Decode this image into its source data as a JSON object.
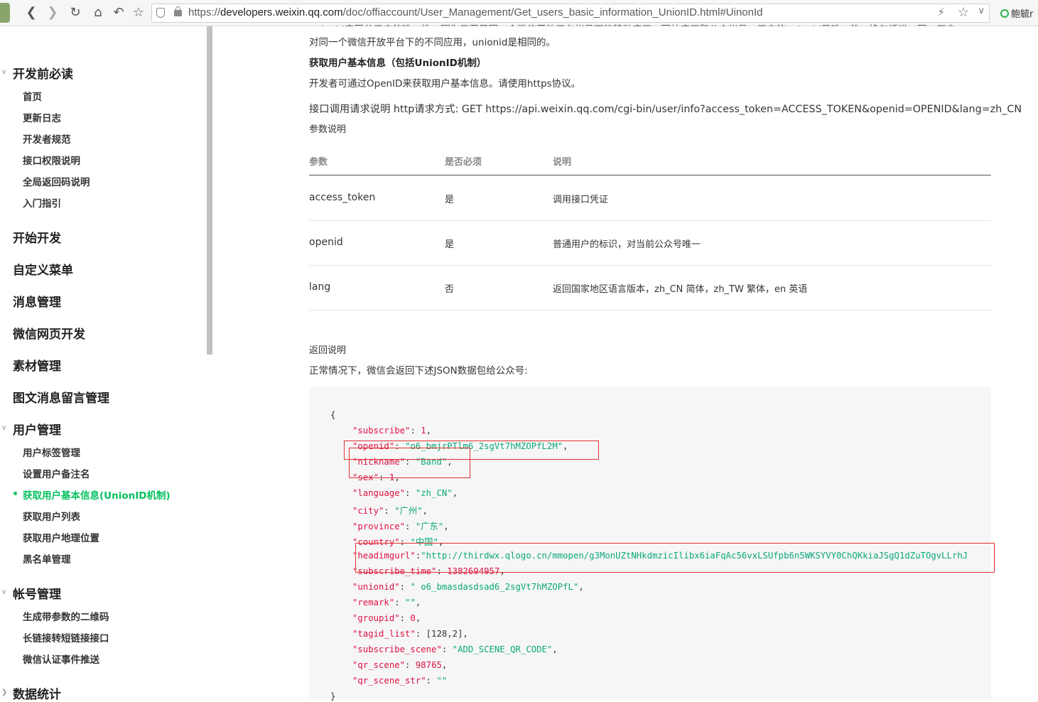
{
  "browser": {
    "url_prefix": "https://",
    "url_host": "developers.weixin.qq.com",
    "url_path": "/doc/offiaccount/User_Management/Get_users_basic_information_UnionID.html#UinonId",
    "extension_label": "鲍毓r"
  },
  "sidebar": {
    "sections": [
      {
        "label": "开发前必读",
        "items": [
          "首页",
          "更新日志",
          "开发者规范",
          "接口权限说明",
          "全局返回码说明",
          "入门指引"
        ]
      },
      {
        "label": "开始开发"
      },
      {
        "label": "自定义菜单"
      },
      {
        "label": "消息管理"
      },
      {
        "label": "微信网页开发"
      },
      {
        "label": "素材管理"
      },
      {
        "label": "图文消息留言管理"
      },
      {
        "label": "用户管理",
        "items": [
          "用户标签管理",
          "设置用户备注名",
          "获取用户基本信息(UnionID机制)",
          "获取用户列表",
          "获取用户地理位置",
          "黑名单管理"
        ],
        "active_item": "获取用户基本信息(UnionID机制)"
      },
      {
        "label": "帐号管理",
        "items": [
          "生成带参数的二维码",
          "长链接转短链接接口",
          "微信认证事件推送"
        ]
      },
      {
        "label": "数据统计"
      }
    ]
  },
  "content": {
    "intro_line_cut": "unionid来区分用户的唯一性，因为只要是同一个微信开放平台帐号下的移动应用、网站应用和公众帐号，用户的unionid是唯一的。换句话说，同一用户，",
    "intro_line2": "对同一个微信开放平台下的不同应用，unionid是相同的。",
    "heading": "获取用户基本信息（包括UnionID机制）",
    "desc": "开发者可通过OpenID来获取用户基本信息。请使用https协议。",
    "request": "接口调用请求说明 http请求方式: GET https://api.weixin.qq.com/cgi-bin/user/info?access_token=ACCESS_TOKEN&openid=OPENID&lang=zh_CN",
    "params_title": "参数说明",
    "table": {
      "headers": [
        "参数",
        "是否必须",
        "说明"
      ],
      "rows": [
        [
          "access_token",
          "是",
          "调用接口凭证"
        ],
        [
          "openid",
          "是",
          "普通用户的标识，对当前公众号唯一"
        ],
        [
          "lang",
          "否",
          "返回国家地区语言版本，zh_CN 简体，zh_TW 繁体，en 英语"
        ]
      ]
    },
    "return_title": "返回说明",
    "return_desc": "正常情况下，微信会返回下述JSON数据包给公众号:",
    "json_lines": [
      {
        "key": "",
        "val": "{",
        "type": "brace"
      },
      {
        "key": "\"subscribe\"",
        "val": "1",
        "type": "num"
      },
      {
        "key": "\"openid\"",
        "val": "\"o6_bmjrPTlm6_2sgVt7hMZOPfL2M\"",
        "type": "str"
      },
      {
        "key": "\"nickname\"",
        "val": "\"Band\"",
        "type": "str"
      },
      {
        "key": "\"sex\"",
        "val": "1",
        "type": "num"
      },
      {
        "key": "\"language\"",
        "val": "\"zh_CN\"",
        "type": "str"
      },
      {
        "key": "\"city\"",
        "val": "\"广州\"",
        "type": "str"
      },
      {
        "key": "\"province\"",
        "val": "\"广东\"",
        "type": "str"
      },
      {
        "key": "\"country\"",
        "val": "\"中国\"",
        "type": "str"
      },
      {
        "key": "\"headimgurl\"",
        "val": "\"http://thirdwx.qlogo.cn/mmopen/g3MonUZtNHkdmzicIlibx6iaFqAc56vxLSUfpb6n5WKSYVY0ChQKkiaJSgQ1dZuTOgvLLrhJ",
        "type": "str"
      },
      {
        "key": "\"subscribe_time\"",
        "val": "1382694957",
        "type": "num"
      },
      {
        "key": "\"unionid\"",
        "val": "\" o6_bmasdasdsad6_2sgVt7hMZOPfL\"",
        "type": "str"
      },
      {
        "key": "\"remark\"",
        "val": "\"\"",
        "type": "str"
      },
      {
        "key": "\"groupid\"",
        "val": "0",
        "type": "num"
      },
      {
        "key": "\"tagid_list\"",
        "val": "[128,2]",
        "type": "arr"
      },
      {
        "key": "\"subscribe_scene\"",
        "val": "\"ADD_SCENE_QR_CODE\"",
        "type": "str"
      },
      {
        "key": "\"qr_scene\"",
        "val": "98765",
        "type": "num"
      },
      {
        "key": "\"qr_scene_str\"",
        "val": "\"\"",
        "type": "str"
      }
    ]
  },
  "colors": {
    "accent": "#07c160",
    "annotation": "#e03030"
  }
}
